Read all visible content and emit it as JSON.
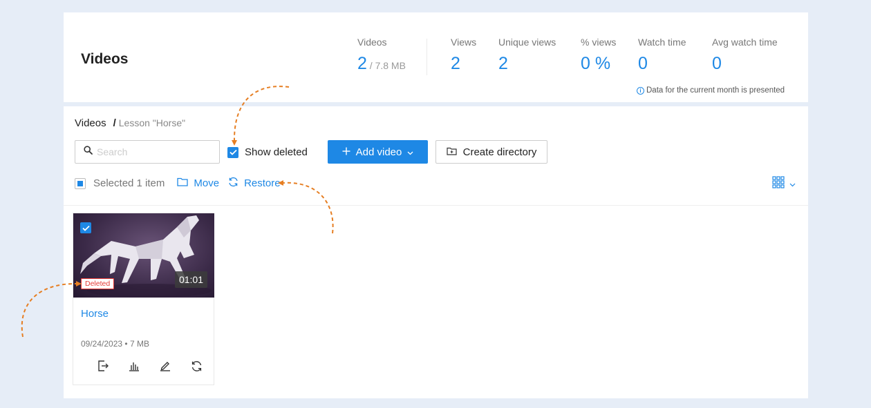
{
  "header": {
    "title": "Videos",
    "stats": [
      {
        "label": "Videos",
        "value": "2",
        "sub": " / 7.8 MB"
      },
      {
        "label": "Views",
        "value": "2"
      },
      {
        "label": "Unique views",
        "value": "2"
      },
      {
        "label": "% views",
        "value": "0 %"
      },
      {
        "label": "Watch time",
        "value": "0"
      },
      {
        "label": "Avg watch time",
        "value": "0"
      }
    ],
    "note": "Data for the current month is presented"
  },
  "breadcrumb": {
    "root": "Videos",
    "separator": "/",
    "current": "Lesson \"Horse\""
  },
  "toolbar": {
    "search_placeholder": "Search",
    "show_deleted_label": "Show deleted",
    "add_video_label": "Add video",
    "create_directory_label": "Create directory"
  },
  "selection": {
    "text": "Selected 1 item",
    "move_label": "Move",
    "restore_label": "Restore"
  },
  "videos": [
    {
      "title": "Horse",
      "duration": "01:01",
      "badge": "Deleted",
      "date": "09/24/2023",
      "size": "7 MB"
    }
  ],
  "colors": {
    "accent": "#1e88e5",
    "deleted": "#e53935",
    "annotation": "#e67e22"
  }
}
